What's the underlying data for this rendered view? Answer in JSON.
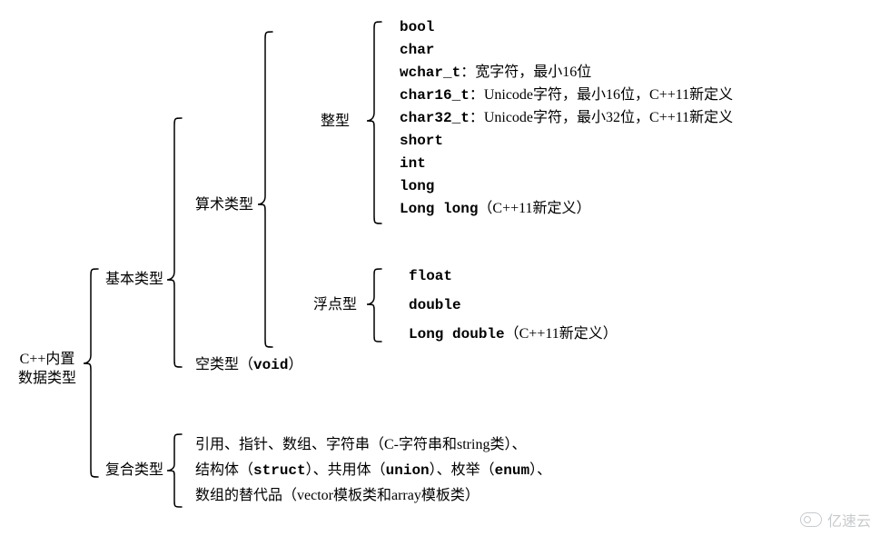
{
  "root_title_line1": "C++内置",
  "root_title_line2": "数据类型",
  "basic_types": "基本类型",
  "compound_types": "复合类型",
  "arithmetic_types": "算术类型",
  "void_type": "空类型（",
  "void_kw": "void",
  "void_tail": "）",
  "integral": "整型",
  "floating": "浮点型",
  "int_items": [
    {
      "kw": "bool"
    },
    {
      "kw": "char"
    },
    {
      "kw": "wchar_t",
      "note": "：宽字符，最小16位"
    },
    {
      "kw": "char16_t",
      "note": "：Unicode字符，最小16位，C++11新定义"
    },
    {
      "kw": "char32_t",
      "note": "：Unicode字符，最小32位，C++11新定义"
    },
    {
      "kw": "short"
    },
    {
      "kw": "int"
    },
    {
      "kw": "long"
    },
    {
      "kw": "Long long",
      "note2": "（C++11新定义）"
    }
  ],
  "float_items": [
    {
      "kw": "float"
    },
    {
      "kw": "double"
    },
    {
      "kw": "Long double",
      "note2": "（C++11新定义）"
    }
  ],
  "compound_line1_pre": "引用、指针、数组、字符串（C-字符串和string类）、",
  "compound_line2_pre": "结构体（",
  "compound_struct": "struct",
  "compound_line2_mid": "）、共用体（",
  "compound_union": "union",
  "compound_line2_mid2": "）、枚举（",
  "compound_enum": "enum",
  "compound_line2_end": "）、",
  "compound_line3": "数组的替代品（vector模板类和array模板类）",
  "watermark_text": "亿速云"
}
